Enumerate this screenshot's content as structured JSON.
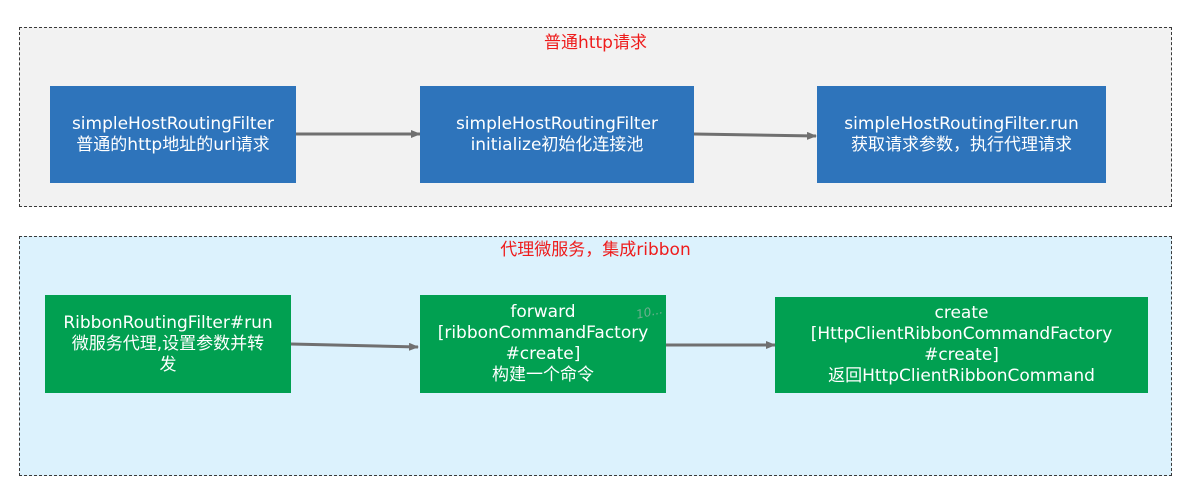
{
  "colors": {
    "http_group_fill": "#f2f2f2",
    "ribbon_group_fill": "#dcf2fd",
    "blue_box": "#2e74bb",
    "green_box": "#01a051",
    "title_red": "#ee1c1c",
    "arrow": "#707070"
  },
  "groups": [
    {
      "title": "普通http请求",
      "nodes": [
        "simpleHostRoutingFilter\n普通的http地址的url请求",
        "simpleHostRoutingFilter\ninitialize初始化连接池",
        "simpleHostRoutingFilter.run\n获取请求参数，执行代理请求"
      ]
    },
    {
      "title": "代理微服务，集成ribbon",
      "nodes": [
        "RibbonRoutingFilter#run\n微服务代理,设置参数并转\n发",
        "forward\n[ribbonCommandFactory\n#create]\n构建一个命令",
        "create\n[HttpClientRibbonCommandFactory\n#create]\n返回HttpClientRibbonCommand"
      ]
    }
  ],
  "watermark": "10..."
}
